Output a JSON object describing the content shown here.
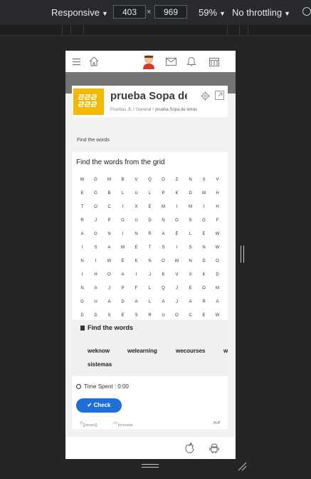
{
  "devtools": {
    "device": "Responsive",
    "width": "403",
    "times": "×",
    "height": "969",
    "zoom": "59%",
    "throttling": "No throttling"
  },
  "page": {
    "course_title": "prueba Sopa de letras",
    "breadcrumb": [
      "Pruebas JL",
      "General",
      "prueba Sopa de letras"
    ],
    "breadcrumb_sep": "/",
    "section_label": "Find the words",
    "game": {
      "title": "Find the words from the grid",
      "grid": [
        [
          "W",
          "G",
          "M",
          "B",
          "V",
          "Q",
          "O",
          "Z",
          "N",
          "X",
          "V"
        ],
        [
          "E",
          "G",
          "B",
          "L",
          "U",
          "L",
          "P",
          "K",
          "D",
          "W",
          "H"
        ],
        [
          "T",
          "O",
          "C",
          "I",
          "X",
          "E",
          "M",
          "I",
          "M",
          "I",
          "H"
        ],
        [
          "R",
          "J",
          "P",
          "O",
          "U",
          "D",
          "N",
          "O",
          "S",
          "G",
          "F"
        ],
        [
          "A",
          "G",
          "N",
          "I",
          "N",
          "R",
          "A",
          "E",
          "L",
          "E",
          "W"
        ],
        [
          "I",
          "S",
          "A",
          "M",
          "E",
          "T",
          "S",
          "I",
          "S",
          "N",
          "W"
        ],
        [
          "N",
          "I",
          "W",
          "E",
          "K",
          "N",
          "O",
          "W",
          "N",
          "D",
          "O"
        ],
        [
          "I",
          "H",
          "O",
          "A",
          "I",
          "J",
          "K",
          "V",
          "X",
          "K",
          "D"
        ],
        [
          "N",
          "A",
          "J",
          "P",
          "F",
          "L",
          "Q",
          "J",
          "E",
          "O",
          "M"
        ],
        [
          "G",
          "U",
          "A",
          "D",
          "A",
          "L",
          "A",
          "J",
          "A",
          "R",
          "A"
        ],
        [
          "D",
          "D",
          "S",
          "E",
          "S",
          "R",
          "U",
          "O",
          "C",
          "E",
          "W"
        ]
      ],
      "words_title": "Find the words",
      "words": [
        "weknow",
        "welearning",
        "wecourses",
        "w",
        "sistemas"
      ],
      "time_spent": "Time Spent : 0:00",
      "check_label": "Check",
      "reuse_label": "[[reuse]]",
      "embed_label": "Incrustar",
      "h5p_label": "H-P"
    }
  },
  "colors": {
    "accent": "#1f6fd8",
    "logo": "#f5b800",
    "header_band": "#757575"
  },
  "icons": [
    "menu-icon",
    "home-icon",
    "avatar",
    "mail-icon",
    "bell-icon",
    "calendar-icon",
    "gear-icon",
    "expand-icon",
    "book-icon",
    "clock-icon",
    "check-icon",
    "apple-icon",
    "android-icon"
  ]
}
